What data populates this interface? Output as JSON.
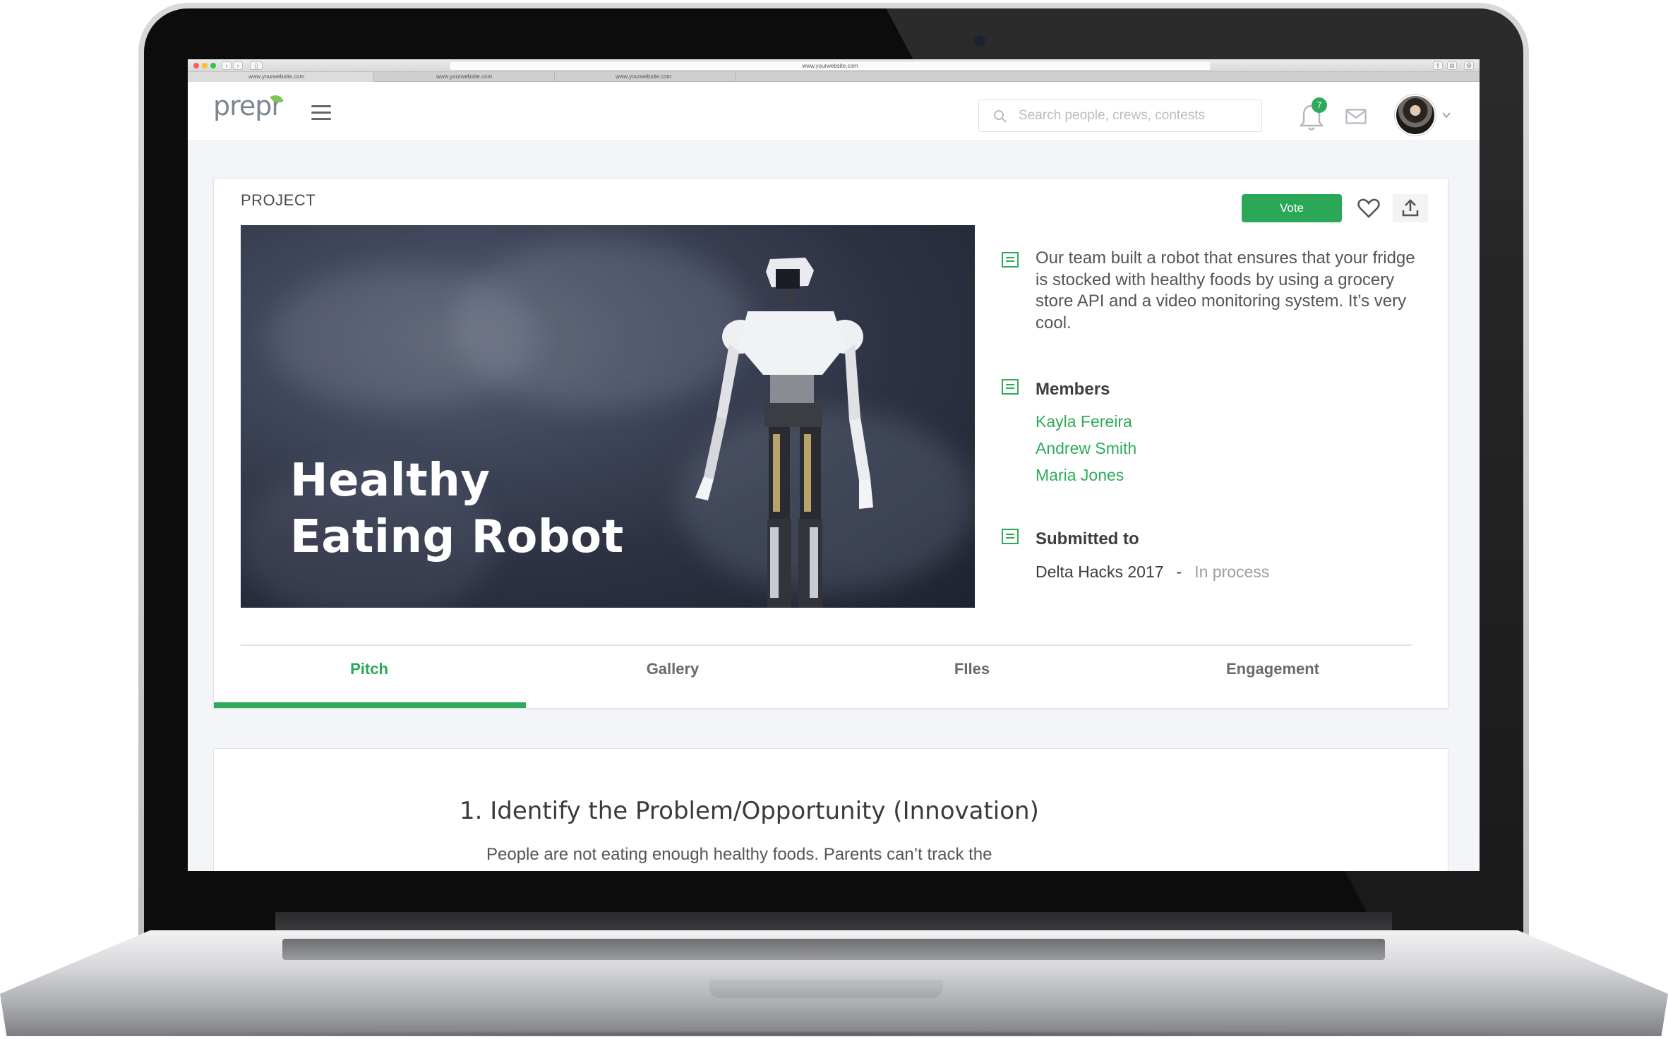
{
  "browser": {
    "url": "www.yourwebsite.com",
    "tabs": [
      "www.yourwebsite.com",
      "www.yourwebsite.com",
      "www.yourwebsite.com"
    ]
  },
  "header": {
    "logo_text": "prepr",
    "search_placeholder": "Search people, crews, contests",
    "notification_count": "7"
  },
  "project": {
    "label": "PROJECT",
    "vote_label": "Vote",
    "title": "Healthy Eating Robot",
    "description": "Our team built a robot that ensures that your fridge is stocked with healthy foods by using a grocery store API and a video monitoring system. It’s very cool.",
    "members_title": "Members",
    "members": [
      "Kayla Fereira",
      "Andrew Smith",
      "Maria Jones"
    ],
    "submitted_title": "Submitted to",
    "submitted_event": "Delta Hacks 2017",
    "submitted_separator": "-",
    "submitted_status": "In process"
  },
  "tabs": [
    "Pitch",
    "Gallery",
    "FIles",
    "Engagement"
  ],
  "active_tab": "Pitch",
  "pitch": {
    "heading": "1. Identify the Problem/Opportunity (Innovation)",
    "text": "People are not eating enough healthy foods. Parents can’t track the"
  },
  "colors": {
    "accent": "#2aa858",
    "text": "#555555",
    "page_bg": "#f4f5f8"
  }
}
